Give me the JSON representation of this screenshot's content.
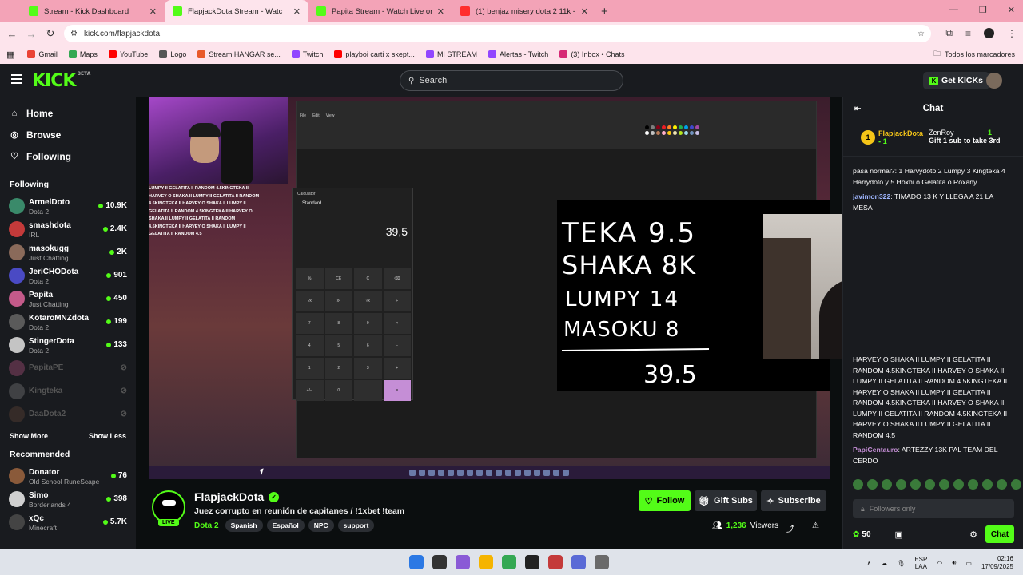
{
  "browser": {
    "tabs": [
      {
        "title": "Stream - Kick Dashboard",
        "color": "#53fc18",
        "active": false
      },
      {
        "title": "FlapjackDota Stream - Watc",
        "color": "#53fc18",
        "active": true
      },
      {
        "title": "Papita Stream - Watch Live on",
        "color": "#53fc18",
        "active": false
      },
      {
        "title": "(1) benjaz misery dota 2 11k - Y",
        "color": "#ff2d2d",
        "active": false
      }
    ],
    "url": "kick.com/flapjackdota",
    "bookmarks": [
      {
        "label": "Gmail",
        "color": "#ea4335"
      },
      {
        "label": "Maps",
        "color": "#34a853"
      },
      {
        "label": "YouTube",
        "color": "#ff0000"
      },
      {
        "label": "Logo",
        "color": "#555555"
      },
      {
        "label": "Stream HANGAR se...",
        "color": "#e85a2a"
      },
      {
        "label": "Twitch",
        "color": "#9146ff"
      },
      {
        "label": "playboi carti x skept...",
        "color": "#ff0000"
      },
      {
        "label": "MI STREAM",
        "color": "#9146ff"
      },
      {
        "label": "Alertas - Twitch",
        "color": "#9146ff"
      },
      {
        "label": "(3) Inbox • Chats",
        "color": "#d62976"
      }
    ],
    "all_bookmarks": "Todos los marcadores"
  },
  "header": {
    "logo": "KICK",
    "logo_badge": "BETA",
    "search_placeholder": "Search",
    "get_kicks": "Get KICKs"
  },
  "sidebar": {
    "nav": [
      {
        "label": "Home",
        "icon": "home-icon"
      },
      {
        "label": "Browse",
        "icon": "compass-icon"
      },
      {
        "label": "Following",
        "icon": "heart-icon"
      }
    ],
    "following_title": "Following",
    "following": [
      {
        "name": "ArmelDoto",
        "category": "Dota 2",
        "viewers": "10.9K",
        "color": "#3a8a6a"
      },
      {
        "name": "smashdota",
        "category": "IRL",
        "viewers": "2.4K",
        "color": "#c43a3a"
      },
      {
        "name": "masokugg",
        "category": "Just Chatting",
        "viewers": "2K",
        "color": "#8a6a5a"
      },
      {
        "name": "JeriCHODota",
        "category": "Dota 2",
        "viewers": "901",
        "color": "#4a4ac4"
      },
      {
        "name": "Papita",
        "category": "Just Chatting",
        "viewers": "450",
        "color": "#c45a8a"
      },
      {
        "name": "KotaroMNZdota",
        "category": "Dota 2",
        "viewers": "199",
        "color": "#5a5a5a"
      },
      {
        "name": "StingerDota",
        "category": "Dota 2",
        "viewers": "133",
        "color": "#c4c4c4"
      }
    ],
    "offline": [
      {
        "name": "PapitaPE",
        "color": "#c45a8a"
      },
      {
        "name": "Kingteka",
        "color": "#8a8a8a"
      },
      {
        "name": "DaaDota2",
        "color": "#6a4a3a"
      }
    ],
    "show_more": "Show More",
    "show_less": "Show Less",
    "recommended_title": "Recommended",
    "recommended": [
      {
        "name": "Donator",
        "category": "Old School RuneScape",
        "viewers": "76",
        "color": "#8a5a3a"
      },
      {
        "name": "Simo",
        "category": "Borderlands 4",
        "viewers": "398",
        "color": "#d0d0d0"
      },
      {
        "name": "xQc",
        "category": "Minecraft",
        "viewers": "5.7K",
        "color": "#444444"
      }
    ]
  },
  "video": {
    "overlay_text": "LUMPY II GELATITA II RANDOM 4.5KINGTEKA II HARVEY O SHAKA II LUMPY II GELATITA II RANDOM 4.5KINGTEKA II HARVEY O SHAKA II LUMPY II GELATITA II RANDOM 4.5KINGTEKA II HARVEY O SHAKA II LUMPY II GELATITA II RANDOM 4.5KINGTEKA II HARVEY O SHAKA II LUMPY II GELATITA II RANDOM 4.5",
    "calc_mode": "Standard",
    "calc_display": "39,5",
    "calc_keys": [
      "%",
      "CE",
      "C",
      "⌫",
      "⅟x",
      "x²",
      "√x",
      "÷",
      "7",
      "8",
      "9",
      "×",
      "4",
      "5",
      "6",
      "−",
      "1",
      "2",
      "3",
      "+",
      "+/−",
      "0",
      ",",
      "="
    ],
    "canvas_lines": [
      "TEKA 9.5",
      "SHAKA 8K",
      "LUMPY 14",
      "MASOKU 8",
      "39.5"
    ]
  },
  "stream": {
    "name": "FlapjackDota",
    "live": "LIVE",
    "title": "Juez corrupto en reunión de capitanes / !1xbet !team",
    "game": "Dota 2",
    "tags": [
      "Spanish",
      "Español",
      "NPC",
      "support"
    ],
    "follow": "Follow",
    "gift_subs": "Gift Subs",
    "subscribe": "Subscribe",
    "viewers": "1,236",
    "viewers_label": "Viewers"
  },
  "chat": {
    "title": "Chat",
    "pinned_user": "FlapjackDota",
    "pinned_count": "1",
    "gifter": "ZenRoy",
    "gifter_count": "1",
    "gift_text": "Gift 1 sub to take 3rd",
    "messages": [
      {
        "user": "",
        "color": "#ffffff",
        "text": "pasa normal?: 1 Harvydoto 2 Lumpy 3 Kingteka 4 Harrydoto y 5 Hoxhi o Gelatita o Roxany"
      },
      {
        "user": "javimon322",
        "color": "#9fb6ff",
        "text": "TIMADO 13 K Y LLEGA A 21 LA MESA"
      }
    ],
    "messages_after": [
      {
        "user": "",
        "color": "#ffffff",
        "text": "HARVEY O SHAKA II LUMPY II GELATITA II RANDOM 4.5KINGTEKA II HARVEY O SHAKA II LUMPY II GELATITA II RANDOM 4.5KINGTEKA II HARVEY O SHAKA II LUMPY II GELATITA II RANDOM 4.5KINGTEKA II HARVEY O SHAKA II LUMPY II GELATITA II RANDOM 4.5KINGTEKA II HARVEY O SHAKA II LUMPY II GELATITA II RANDOM 4.5"
      },
      {
        "user": "PapiCentauro",
        "color": "#c58ed6",
        "text": "ARTEZZY 13K PAL TEAM DEL CERDO"
      }
    ],
    "input_placeholder": "Followers only",
    "points": "50",
    "chat_button": "Chat"
  },
  "taskbar": {
    "lang": "ESP",
    "lang2": "LAA",
    "time": "02:16",
    "date": "17/09/2025",
    "apps": [
      "#2b78e4",
      "#333333",
      "#8a5ad6",
      "#f5b400",
      "#34a853",
      "#222222",
      "#c43a3a",
      "#5a6ad6",
      "#6a6a6a"
    ]
  },
  "colors": {
    "accent": "#53fc18",
    "tabbar": "#f3a3b7"
  }
}
